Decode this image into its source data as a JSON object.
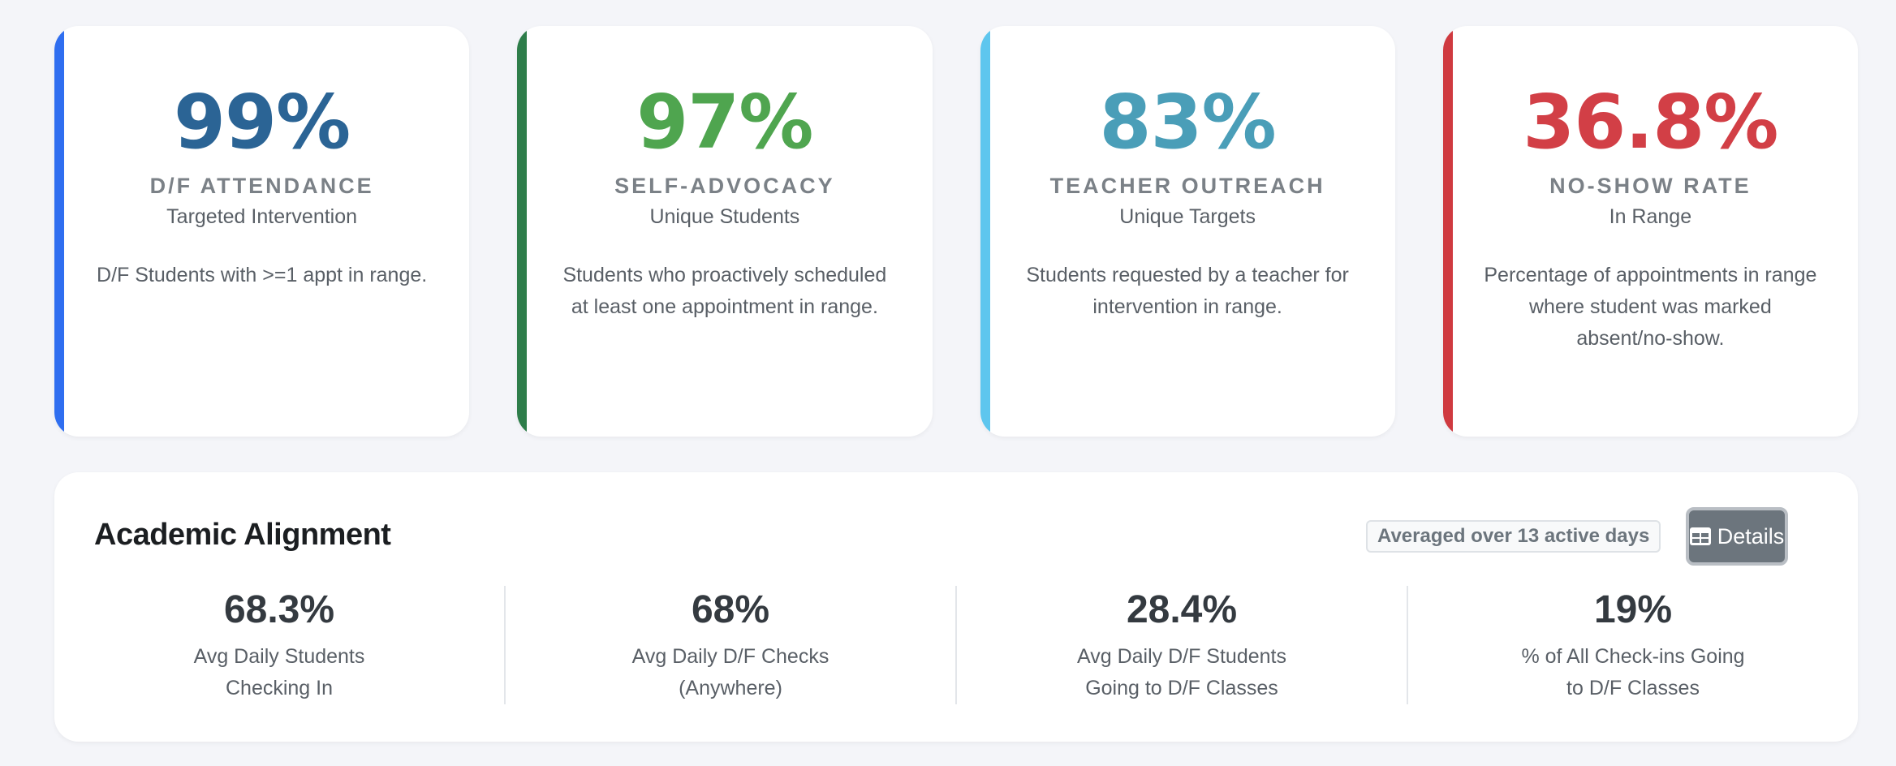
{
  "stat_cards": [
    {
      "value": "99%",
      "title": "D/F Attendance",
      "subtitle": "Targeted Intervention",
      "description": "D/F Students with >=1 appt in range.",
      "value_color": "#2b6495",
      "accent_color": "#2f6ef0"
    },
    {
      "value": "97%",
      "title": "Self-Advocacy",
      "subtitle": "Unique Students",
      "description": "Students who proactively scheduled at least one appointment in range.",
      "value_color": "#4fa54f",
      "accent_color": "#2e7d4a"
    },
    {
      "value": "83%",
      "title": "Teacher Outreach",
      "subtitle": "Unique Targets",
      "description": "Students requested by a teacher for intervention in range.",
      "value_color": "#4a9eb8",
      "accent_color": "#5ec6ee"
    },
    {
      "value": "36.8%",
      "title": "No-Show Rate",
      "subtitle": "In Range",
      "description": "Percentage of appointments in range where student was marked absent/no-show.",
      "value_color": "#d23f46",
      "accent_color": "#cf3a40"
    }
  ],
  "academic_alignment": {
    "title": "Academic Alignment",
    "badge": "Averaged over 13 active days",
    "details_button": {
      "label": "Details",
      "icon": "table-icon"
    },
    "metrics": [
      {
        "value": "68.3%",
        "label": "Avg Daily Students Checking In"
      },
      {
        "value": "68%",
        "label": "Avg Daily D/F Checks (Anywhere)"
      },
      {
        "value": "28.4%",
        "label": "Avg Daily D/F Students Going to D/F Classes"
      },
      {
        "value": "19%",
        "label": "% of All Check-ins Going to D/F Classes"
      }
    ]
  }
}
